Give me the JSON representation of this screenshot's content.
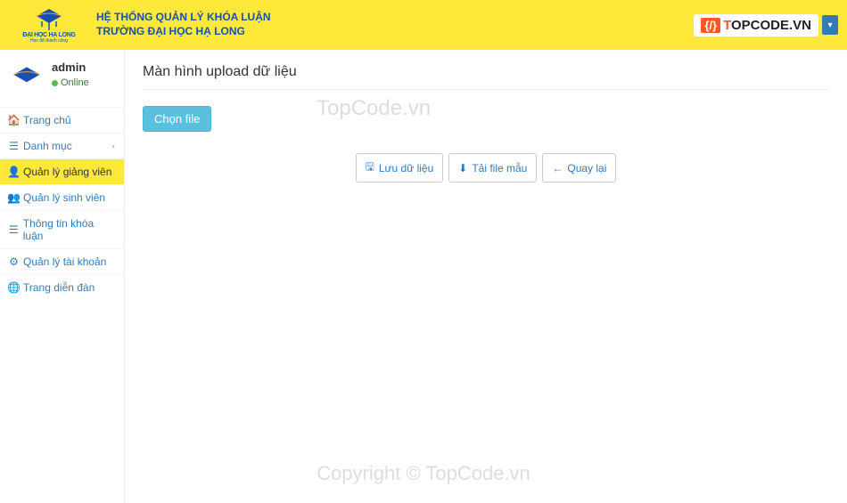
{
  "header": {
    "logo_line1": "ĐẠI HỌC HẠ LONG",
    "logo_line2": "Học để thành công",
    "title_line1": "HỆ THỐNG QUẢN LÝ KHÓA LUẬN",
    "title_line2": "TRƯỜNG ĐẠI HỌC HẠ LONG",
    "topcode_text": "TOPCODE.VN"
  },
  "user": {
    "name": "admin",
    "status": "Online"
  },
  "sidebar": {
    "items": [
      {
        "label": "Trang chủ"
      },
      {
        "label": "Danh mục"
      },
      {
        "label": "Quản lý giảng viên"
      },
      {
        "label": "Quản lý sinh viên"
      },
      {
        "label": "Thông tin khóa luận"
      },
      {
        "label": "Quản lý tài khoản"
      },
      {
        "label": "Trang diễn đàn"
      }
    ]
  },
  "main": {
    "page_title": "Màn hình upload dữ liệu",
    "upload_button": "Chọn file",
    "save_button": "Lưu dữ liệu",
    "template_button": "Tải file mẫu",
    "back_button": "Quay lại"
  },
  "watermark": {
    "text1": "TopCode.vn",
    "text2": "Copyright © TopCode.vn"
  }
}
